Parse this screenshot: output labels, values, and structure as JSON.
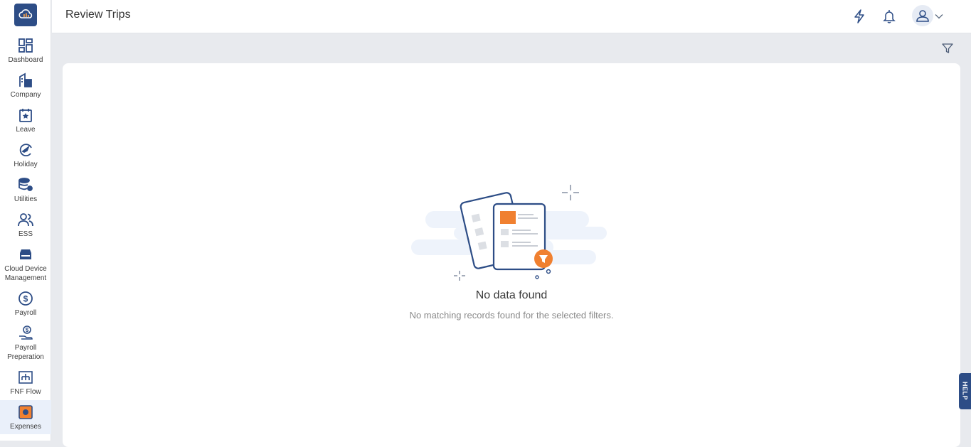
{
  "app": {
    "logo_icon": "cloud-chart-icon",
    "brand_color": "#2d4d86",
    "accent_color": "#f08030"
  },
  "sidebar": {
    "items": [
      {
        "label": "Dashboard",
        "icon": "dashboard-icon"
      },
      {
        "label": "Company",
        "icon": "building-icon"
      },
      {
        "label": "Leave",
        "icon": "calendar-star-icon"
      },
      {
        "label": "Holiday",
        "icon": "plane-icon"
      },
      {
        "label": "Utilities",
        "icon": "database-gear-icon"
      },
      {
        "label": "ESS",
        "icon": "users-icon"
      },
      {
        "label": "Cloud Device Management",
        "icon": "device-icon"
      },
      {
        "label": "Payroll",
        "icon": "dollar-circle-icon"
      },
      {
        "label": "Payroll Preperation",
        "icon": "hand-dollar-icon"
      },
      {
        "label": "FNF Flow",
        "icon": "flow-chart-icon"
      },
      {
        "label": "Expenses",
        "icon": "expenses-icon",
        "active": true
      }
    ]
  },
  "header": {
    "title": "Review Trips",
    "icons": [
      "lightning-icon",
      "bell-icon",
      "user-icon",
      "chevron-down-icon"
    ]
  },
  "toolbar": {
    "filter_icon": "filter-icon"
  },
  "empty_state": {
    "title": "No data found",
    "message": "No matching records found for the selected filters."
  },
  "help": {
    "label": "HELP"
  }
}
